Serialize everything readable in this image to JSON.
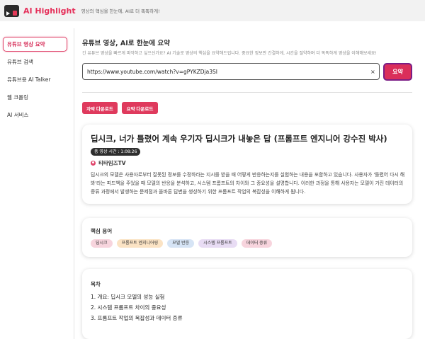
{
  "header": {
    "title": "AI Highlight",
    "subtitle": "영상의 핵심을 한눈에, AI로 더 똑똑하게!"
  },
  "sidebar": {
    "items": [
      {
        "label": "유튜브 영상 요약",
        "active": true
      },
      {
        "label": "유튜브 검색",
        "active": false
      },
      {
        "label": "유튜브용 AI Talker",
        "active": false
      },
      {
        "label": "웹 크롤링",
        "active": false
      },
      {
        "label": "AI 서비스",
        "active": false
      }
    ]
  },
  "main": {
    "title": "유튜브 영상, AI로 한눈에 요약",
    "description": "긴 유튜브 영상을 빠르게 파악하고 싶으신가요? AI 기술로 영상의 핵심을 요약해드립니다. 중요한 정보만 간결하게, 시간을 절약하며 더 똑똑하게 영상을 이해해보세요!",
    "url_value": "https://www.youtube.com/watch?v=gPYKZDja3SI",
    "clear_label": "×",
    "submit_label": "요약",
    "download_subtitle_label": "자막 다운로드",
    "download_summary_label": "요약 다운로드"
  },
  "video": {
    "title": "딥시크, 너가 틀렸어 계속 우기자 딥시크가 내놓은 답 (프롬프트 엔지니어 강수진 박사)",
    "duration": "총 영상 시간 : 1:08:26",
    "channel": "티타임즈TV",
    "summary": "딥시크의 모델은 사용자로부터 잘못된 정보를 수정하라는 지시를 받을 때 어떻게 반응하는지를 실험하는 내용을 포함하고 있습니다. 사용자가 '틀렸어 다시 해봐'라는 피드백을 주었을 때 모델의 반응을 분석하고, 시스템 프롬프트의 차이와 그 중요성을 설명합니다. 이러한 과정을 통해 사용자는 모델이 가진 데이터의 증류 과정에서 발생하는 문제점과 올바른 답변을 생성하기 위한 프롬프트 작업의 복잡성을 이해하게 됩니다."
  },
  "keywords": {
    "label": "핵심 용어",
    "items": [
      {
        "text": "딥시크",
        "color": "#f7d4dd"
      },
      {
        "text": "프롬프트 엔지니어링",
        "color": "#fbe3c4"
      },
      {
        "text": "모델 반응",
        "color": "#d6e4f5"
      },
      {
        "text": "시스템 프롬프트",
        "color": "#e8dcf4"
      },
      {
        "text": "데이터 증류",
        "color": "#f7d4dd"
      }
    ]
  },
  "toc": {
    "label": "목차",
    "items": [
      "1. 개요: 딥시크 모델의 성능 실험",
      "2. 시스템 프롬프트 차이의 중요성",
      "3. 프롬프트 작업의 복잡성과 데이터 증류"
    ]
  },
  "colors": {
    "accent": "#da2e5a",
    "header_bg": "#f2f2f2"
  }
}
